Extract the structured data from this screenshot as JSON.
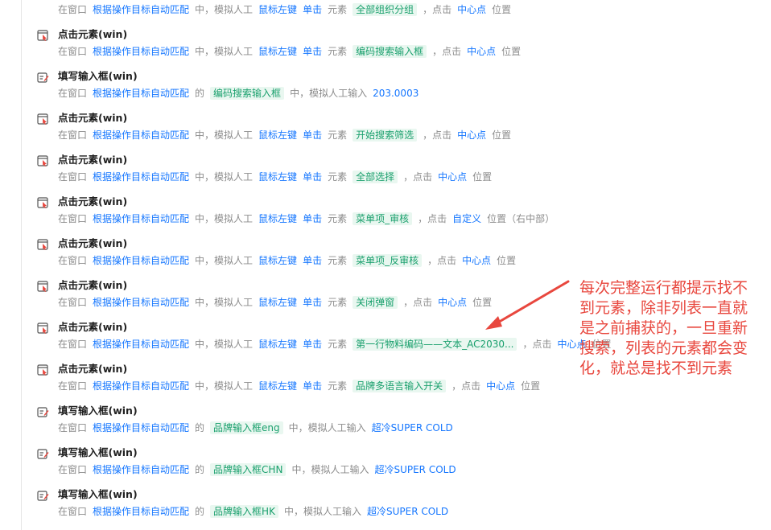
{
  "steps": [
    {
      "title": "",
      "icon": "click-element-icon",
      "desc": [
        {
          "t": "在窗口",
          "s": "plain"
        },
        {
          "t": "根据操作目标自动匹配",
          "s": "blue"
        },
        {
          "t": "中，模拟人工",
          "s": "plain"
        },
        {
          "t": "鼠标左键",
          "s": "blue"
        },
        {
          "t": "单击",
          "s": "blue"
        },
        {
          "t": "元素",
          "s": "plain"
        },
        {
          "t": "全部组织分组",
          "s": "green"
        },
        {
          "t": "，点击",
          "s": "plain"
        },
        {
          "t": "中心点",
          "s": "blue"
        },
        {
          "t": "位置",
          "s": "plain"
        }
      ]
    },
    {
      "title": "点击元素(win)",
      "icon": "click-element-icon",
      "desc": [
        {
          "t": "在窗口",
          "s": "plain"
        },
        {
          "t": "根据操作目标自动匹配",
          "s": "blue"
        },
        {
          "t": "中，模拟人工",
          "s": "plain"
        },
        {
          "t": "鼠标左键",
          "s": "blue"
        },
        {
          "t": "单击",
          "s": "blue"
        },
        {
          "t": "元素",
          "s": "plain"
        },
        {
          "t": "编码搜索输入框",
          "s": "green"
        },
        {
          "t": "，点击",
          "s": "plain"
        },
        {
          "t": "中心点",
          "s": "blue"
        },
        {
          "t": "位置",
          "s": "plain"
        }
      ]
    },
    {
      "title": "填写输入框(win)",
      "icon": "fill-input-icon",
      "desc": [
        {
          "t": "在窗口",
          "s": "plain"
        },
        {
          "t": "根据操作目标自动匹配",
          "s": "blue"
        },
        {
          "t": "的",
          "s": "plain"
        },
        {
          "t": "编码搜索输入框",
          "s": "green"
        },
        {
          "t": "中，模拟人工输入",
          "s": "plain"
        },
        {
          "t": "203.0003",
          "s": "blue"
        }
      ]
    },
    {
      "title": "点击元素(win)",
      "icon": "click-element-icon",
      "desc": [
        {
          "t": "在窗口",
          "s": "plain"
        },
        {
          "t": "根据操作目标自动匹配",
          "s": "blue"
        },
        {
          "t": "中，模拟人工",
          "s": "plain"
        },
        {
          "t": "鼠标左键",
          "s": "blue"
        },
        {
          "t": "单击",
          "s": "blue"
        },
        {
          "t": "元素",
          "s": "plain"
        },
        {
          "t": "开始搜索筛选",
          "s": "green"
        },
        {
          "t": "，点击",
          "s": "plain"
        },
        {
          "t": "中心点",
          "s": "blue"
        },
        {
          "t": "位置",
          "s": "plain"
        }
      ]
    },
    {
      "title": "点击元素(win)",
      "icon": "click-element-icon",
      "desc": [
        {
          "t": "在窗口",
          "s": "plain"
        },
        {
          "t": "根据操作目标自动匹配",
          "s": "blue"
        },
        {
          "t": "中，模拟人工",
          "s": "plain"
        },
        {
          "t": "鼠标左键",
          "s": "blue"
        },
        {
          "t": "单击",
          "s": "blue"
        },
        {
          "t": "元素",
          "s": "plain"
        },
        {
          "t": "全部选择",
          "s": "green"
        },
        {
          "t": "，点击",
          "s": "plain"
        },
        {
          "t": "中心点",
          "s": "blue"
        },
        {
          "t": "位置",
          "s": "plain"
        }
      ]
    },
    {
      "title": "点击元素(win)",
      "icon": "click-element-icon",
      "desc": [
        {
          "t": "在窗口",
          "s": "plain"
        },
        {
          "t": "根据操作目标自动匹配",
          "s": "blue"
        },
        {
          "t": "中，模拟人工",
          "s": "plain"
        },
        {
          "t": "鼠标左键",
          "s": "blue"
        },
        {
          "t": "单击",
          "s": "blue"
        },
        {
          "t": "元素",
          "s": "plain"
        },
        {
          "t": "菜单项_审核",
          "s": "green"
        },
        {
          "t": "，点击",
          "s": "plain"
        },
        {
          "t": "自定义",
          "s": "blue"
        },
        {
          "t": "位置（右中部）",
          "s": "plain"
        }
      ]
    },
    {
      "title": "点击元素(win)",
      "icon": "click-element-icon",
      "desc": [
        {
          "t": "在窗口",
          "s": "plain"
        },
        {
          "t": "根据操作目标自动匹配",
          "s": "blue"
        },
        {
          "t": "中，模拟人工",
          "s": "plain"
        },
        {
          "t": "鼠标左键",
          "s": "blue"
        },
        {
          "t": "单击",
          "s": "blue"
        },
        {
          "t": "元素",
          "s": "plain"
        },
        {
          "t": "菜单项_反审核",
          "s": "green"
        },
        {
          "t": "，点击",
          "s": "plain"
        },
        {
          "t": "中心点",
          "s": "blue"
        },
        {
          "t": "位置",
          "s": "plain"
        }
      ]
    },
    {
      "title": "点击元素(win)",
      "icon": "click-element-icon",
      "desc": [
        {
          "t": "在窗口",
          "s": "plain"
        },
        {
          "t": "根据操作目标自动匹配",
          "s": "blue"
        },
        {
          "t": "中，模拟人工",
          "s": "plain"
        },
        {
          "t": "鼠标左键",
          "s": "blue"
        },
        {
          "t": "单击",
          "s": "blue"
        },
        {
          "t": "元素",
          "s": "plain"
        },
        {
          "t": "关闭弹窗",
          "s": "green"
        },
        {
          "t": "，点击",
          "s": "plain"
        },
        {
          "t": "中心点",
          "s": "blue"
        },
        {
          "t": "位置",
          "s": "plain"
        }
      ]
    },
    {
      "title": "点击元素(win)",
      "icon": "click-element-icon",
      "desc": [
        {
          "t": "在窗口",
          "s": "plain"
        },
        {
          "t": "根据操作目标自动匹配",
          "s": "blue"
        },
        {
          "t": "中，模拟人工",
          "s": "plain"
        },
        {
          "t": "鼠标左键",
          "s": "blue"
        },
        {
          "t": "单击",
          "s": "blue"
        },
        {
          "t": "元素",
          "s": "plain"
        },
        {
          "t": "第一行物料编码——文本_AC2030...",
          "s": "green"
        },
        {
          "t": "，点击",
          "s": "plain"
        },
        {
          "t": "中心点",
          "s": "blue"
        },
        {
          "t": "位置",
          "s": "plain"
        }
      ]
    },
    {
      "title": "点击元素(win)",
      "icon": "click-element-icon",
      "desc": [
        {
          "t": "在窗口",
          "s": "plain"
        },
        {
          "t": "根据操作目标自动匹配",
          "s": "blue"
        },
        {
          "t": "中，模拟人工",
          "s": "plain"
        },
        {
          "t": "鼠标左键",
          "s": "blue"
        },
        {
          "t": "单击",
          "s": "blue"
        },
        {
          "t": "元素",
          "s": "plain"
        },
        {
          "t": "品牌多语言输入开关",
          "s": "green"
        },
        {
          "t": "，点击",
          "s": "plain"
        },
        {
          "t": "中心点",
          "s": "blue"
        },
        {
          "t": "位置",
          "s": "plain"
        }
      ]
    },
    {
      "title": "填写输入框(win)",
      "icon": "fill-input-icon",
      "desc": [
        {
          "t": "在窗口",
          "s": "plain"
        },
        {
          "t": "根据操作目标自动匹配",
          "s": "blue"
        },
        {
          "t": "的",
          "s": "plain"
        },
        {
          "t": "品牌输入框eng",
          "s": "green"
        },
        {
          "t": "中，模拟人工输入",
          "s": "plain"
        },
        {
          "t": "超冷SUPER COLD",
          "s": "blue"
        }
      ]
    },
    {
      "title": "填写输入框(win)",
      "icon": "fill-input-icon",
      "desc": [
        {
          "t": "在窗口",
          "s": "plain"
        },
        {
          "t": "根据操作目标自动匹配",
          "s": "blue"
        },
        {
          "t": "的",
          "s": "plain"
        },
        {
          "t": "品牌输入框CHN",
          "s": "green"
        },
        {
          "t": "中，模拟人工输入",
          "s": "plain"
        },
        {
          "t": "超冷SUPER COLD",
          "s": "blue"
        }
      ]
    },
    {
      "title": "填写输入框(win)",
      "icon": "fill-input-icon",
      "desc": [
        {
          "t": "在窗口",
          "s": "plain"
        },
        {
          "t": "根据操作目标自动匹配",
          "s": "blue"
        },
        {
          "t": "的",
          "s": "plain"
        },
        {
          "t": "品牌输入框HK",
          "s": "green"
        },
        {
          "t": "中，模拟人工输入",
          "s": "plain"
        },
        {
          "t": "超冷SUPER COLD",
          "s": "blue"
        }
      ]
    }
  ],
  "annotation": {
    "text": "每次完整运行都提示找不到元素，除非列表一直就是之前捕获的，一旦重新搜索，列表的元素都会变化，就总是找不到元素",
    "color": "#e8473e"
  },
  "colors": {
    "link_blue": "#1677ff",
    "element_green": "#1aa06d",
    "element_green_bg": "#e9f7f0",
    "muted_text": "#8c8c8c",
    "annotation_red": "#e8473e"
  }
}
